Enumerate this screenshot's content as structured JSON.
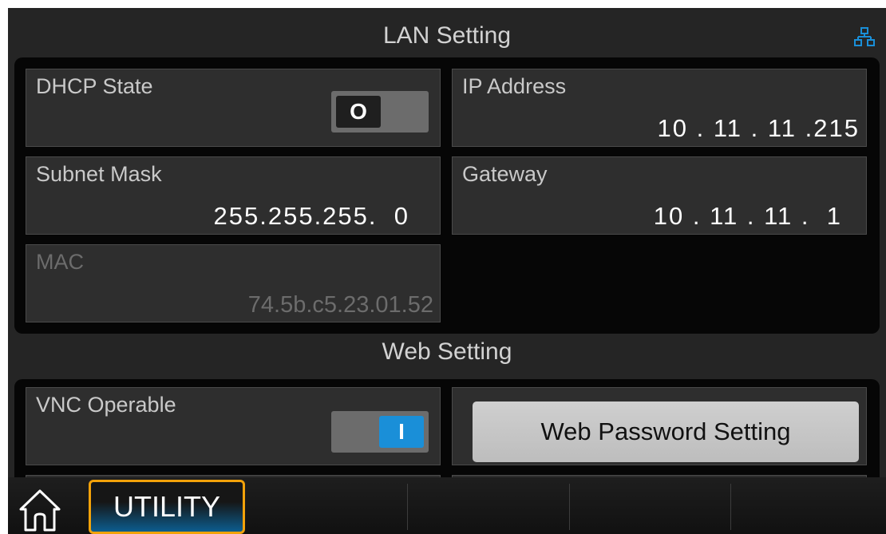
{
  "lan": {
    "title": "LAN Setting",
    "status_icon": "network-icon",
    "dhcp": {
      "label": "DHCP State",
      "toggle_text": "O",
      "state": "off"
    },
    "ip_address": {
      "label": "IP Address",
      "value": "10 . 11 . 11 .215"
    },
    "subnet_mask": {
      "label": "Subnet Mask",
      "value": "255.255.255.  0"
    },
    "gateway": {
      "label": "Gateway",
      "value": "10 . 11 . 11 .  1"
    },
    "mac": {
      "label": "MAC",
      "value": "74.5b.c5.23.01.52"
    }
  },
  "web": {
    "title": "Web Setting",
    "vnc": {
      "label": "VNC Operable",
      "toggle_text": "I",
      "state": "on"
    },
    "password_button": "Web Password Setting"
  },
  "bottom_bar": {
    "home_icon": "home-icon",
    "active_tab": "UTILITY"
  },
  "colors": {
    "accent_on": "#1a8fd8",
    "active_tab_border": "#f2a20a",
    "network_icon": "#1a8fd8"
  }
}
